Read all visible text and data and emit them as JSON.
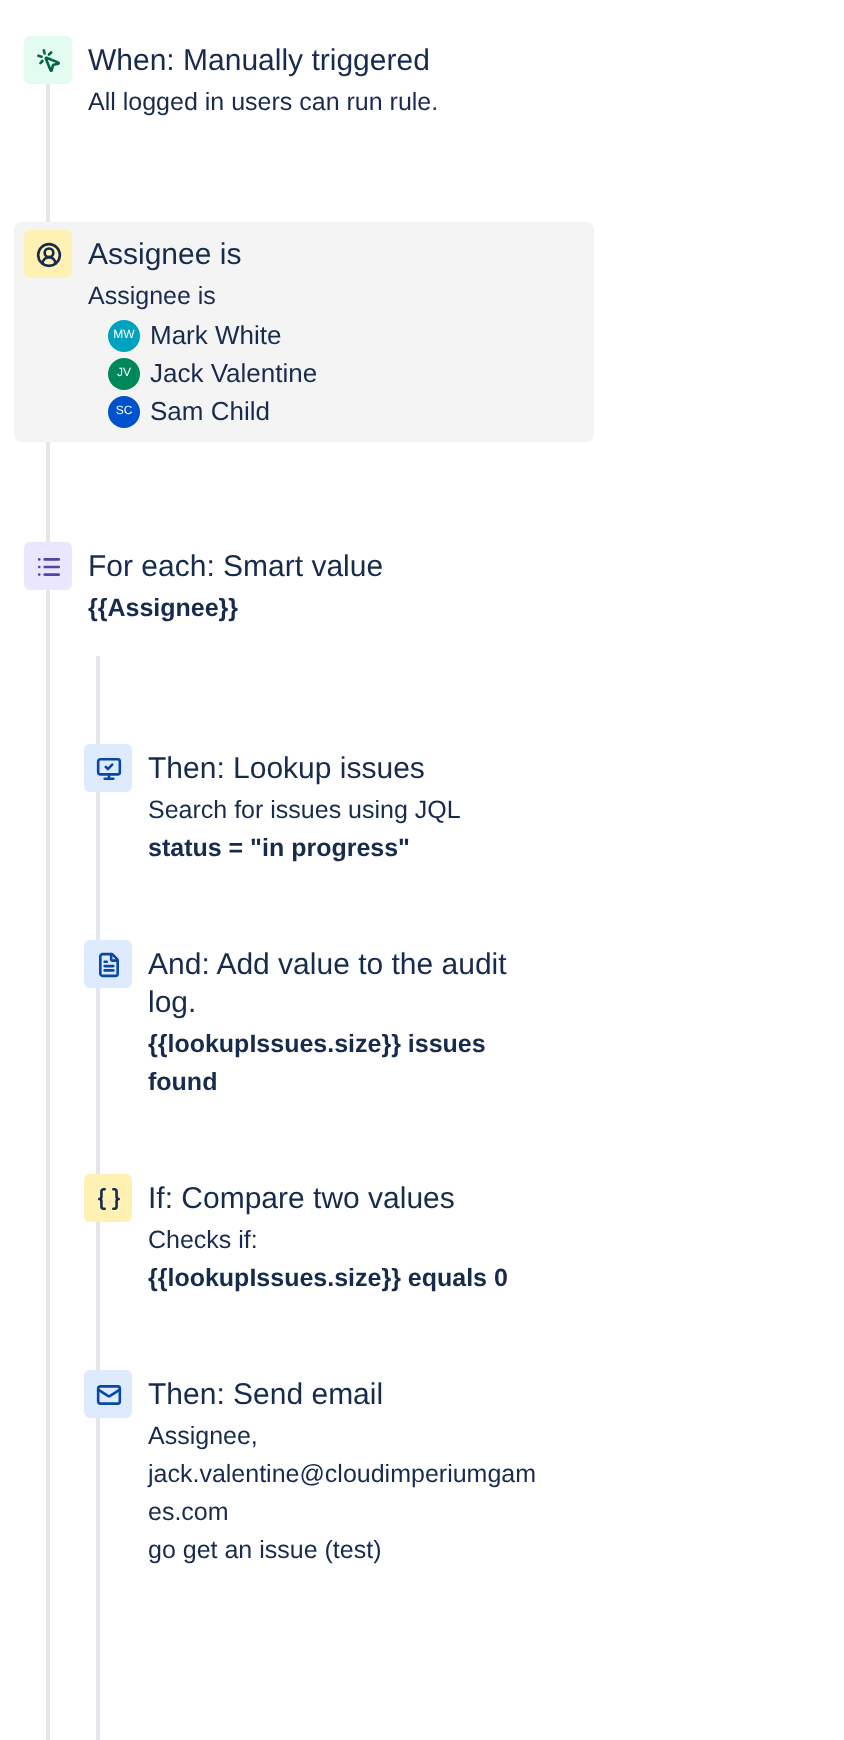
{
  "steps": [
    {
      "kind": "trigger",
      "title": "When: Manually triggered",
      "selected": false,
      "lines": [
        {
          "text": "All logged in users can run rule.",
          "bold": false
        }
      ]
    },
    {
      "kind": "user-condition",
      "title": "Assignee is",
      "selected": true,
      "lines": [
        {
          "text": "Assignee is",
          "bold": false
        }
      ],
      "users": [
        {
          "initials": "MW",
          "name": "Mark White",
          "color": "#00a3bf"
        },
        {
          "initials": "JV",
          "name": "Jack Valentine",
          "color": "#00875a"
        },
        {
          "initials": "SC",
          "name": "Sam Child",
          "color": "#0052cc"
        }
      ]
    },
    {
      "kind": "branch",
      "title": "For each: Smart value",
      "selected": false,
      "lines": [
        {
          "text": "{{Assignee}}",
          "bold": true
        }
      ],
      "children": [
        {
          "kind": "lookup",
          "title": "Then: Lookup issues",
          "selected": false,
          "lines": [
            {
              "text": "Search for issues using JQL",
              "bold": false
            },
            {
              "text": "status = \"in progress\"",
              "bold": true
            }
          ]
        },
        {
          "kind": "audit-log",
          "title": "And: Add value to the audit log.",
          "selected": false,
          "lines": [
            {
              "text": "{{lookupIssues.size}} issues found",
              "bold": true
            }
          ]
        },
        {
          "kind": "compare",
          "title": "If: Compare two values",
          "selected": false,
          "lines": [
            {
              "text": "Checks if:",
              "bold": false
            },
            {
              "text": "{{lookupIssues.size}} equals 0",
              "bold": true
            }
          ]
        },
        {
          "kind": "email",
          "title": "Then: Send email",
          "selected": false,
          "lines": [
            {
              "text": "Assignee,",
              "bold": false
            },
            {
              "text": "jack.valentine@cloudimperiumgames.com",
              "bold": false
            },
            {
              "text": "go get an issue (test)",
              "bold": false
            }
          ]
        }
      ]
    }
  ]
}
